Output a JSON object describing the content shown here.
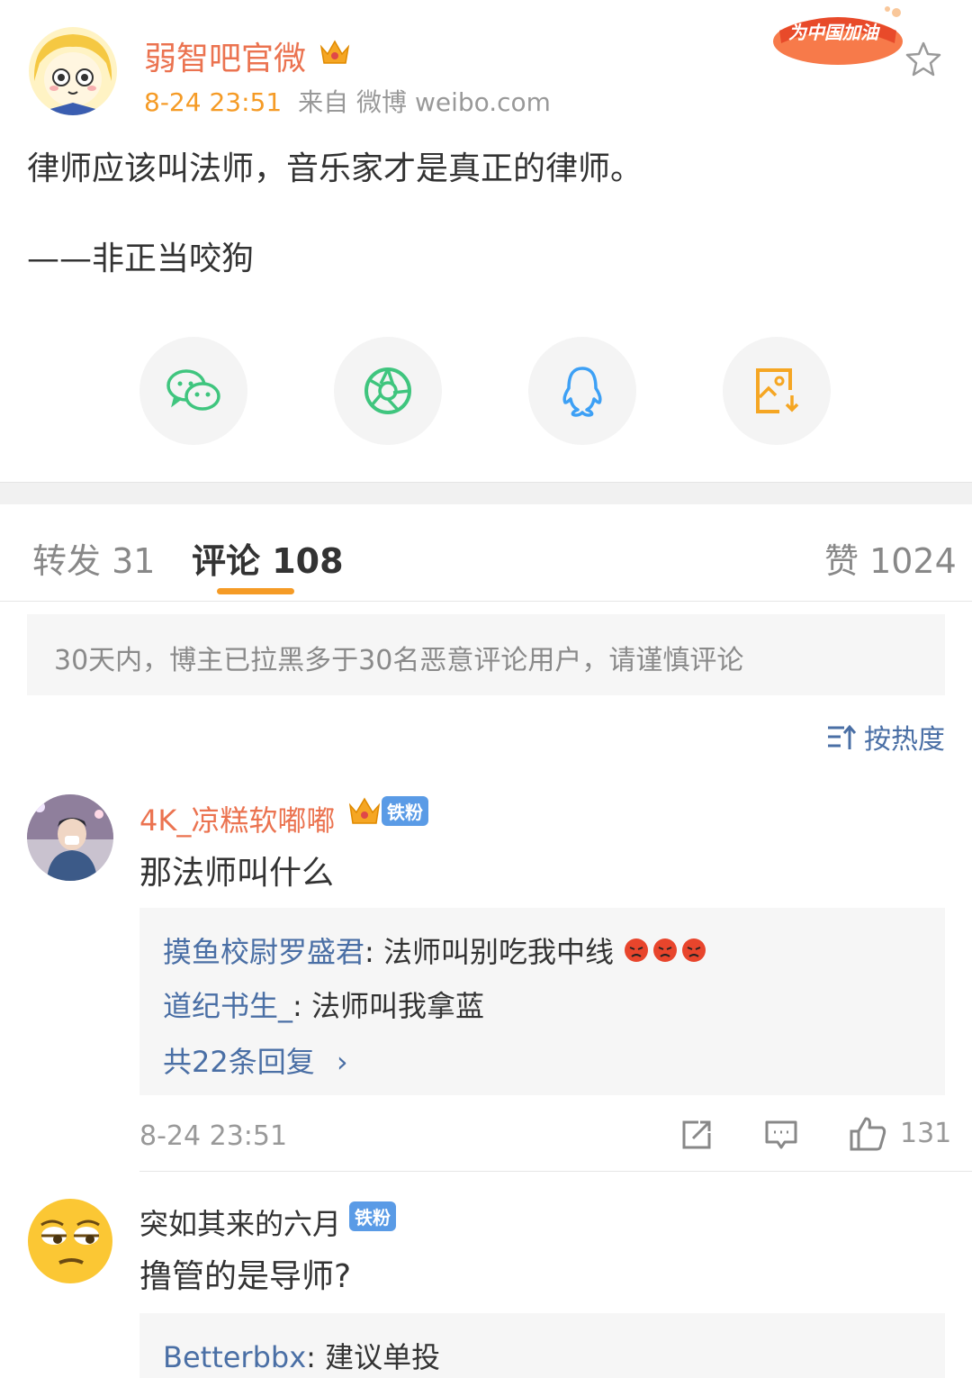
{
  "post": {
    "author": "弱智吧官微",
    "time": "8-24 23:51",
    "source": "来自 微博 weibo.com",
    "event_badge": "为中国加油",
    "line1": "律师应该叫法师，音乐家才是真正的律师。",
    "line2": "——非正当咬狗"
  },
  "share": [
    "wechat-icon",
    "moments-icon",
    "qq-icon",
    "save-image-icon"
  ],
  "tabs": {
    "repost": "转发 31",
    "comment": "评论 108",
    "like": "赞 1024"
  },
  "notice": "30天内，博主已拉黑多于30名恶意评论用户，请谨慎评论",
  "sort_label": "按热度",
  "comments": [
    {
      "user": "4K_凉糕软嘟嘟",
      "badge": "铁粉",
      "text": "那法师叫什么",
      "replies": [
        {
          "user": "摸鱼校尉罗盛君",
          "text": ": 法师叫别吃我中线"
        },
        {
          "user": "道纪书生_",
          "text": ": 法师叫我拿蓝"
        }
      ],
      "more": "共22条回复",
      "time": "8-24 23:51",
      "likes": "131"
    },
    {
      "user": "突如其来的六月",
      "badge": "铁粉",
      "text": "撸管的是导师?",
      "replies": [
        {
          "user": "Betterbbx",
          "text": ": 建议单投"
        }
      ]
    }
  ],
  "colors": {
    "author": "#eb7350",
    "time": "#f59b26",
    "link": "#4a6fa5",
    "badge": "#5a9be6",
    "tab_underline": "#f59b26"
  }
}
